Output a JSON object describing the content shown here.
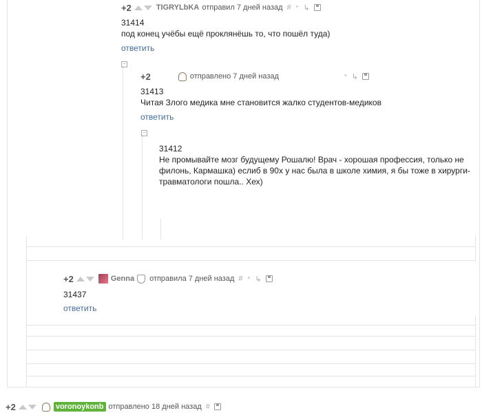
{
  "c1": {
    "rating": "+2",
    "author": "TIGRYLbKA",
    "posted": "отправил 7 дней назад",
    "id": "31414",
    "text": "под конец  учёбы ещё проклянёшь то, что пошёл туда)",
    "reply": "ответить"
  },
  "c2": {
    "rating": "+2",
    "posted": "отправлено 7 дней назад",
    "id": "31413",
    "text": "Читая Злого медика мне становится жалко студентов-медиков",
    "reply": "ответить"
  },
  "c3": {
    "id": "31412",
    "line1": "Не промывайте мозг будущему Рошалю! Врач - хорошая профессия, только не",
    "line2": "филонь, Кармашка) еслиб в 90х у нас была в школе химия, я бы тоже в хирурги-",
    "line3": "травматологи пошла.. Хех)"
  },
  "c4": {
    "rating": "+2",
    "author": "Genna",
    "posted": "отправила 7 дней назад",
    "id": "31437",
    "reply": "ответить"
  },
  "c5": {
    "rating": "+2",
    "author": "voronoykonb",
    "posted": "отправлено 18 дней назад"
  },
  "icons": {
    "hash": "#",
    "plus": "⁺",
    "branch": "↳",
    "collapse": "⊟"
  },
  "colors": {
    "link": "#3a6ea5",
    "badge": "#5fb339"
  }
}
